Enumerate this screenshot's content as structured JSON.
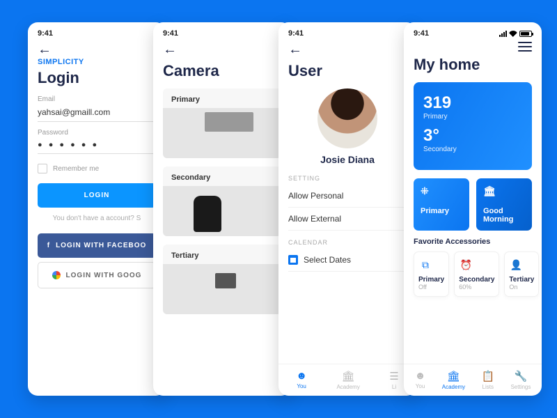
{
  "time": "9:41",
  "login": {
    "brand": "SIMPLICITY",
    "title": "Login",
    "email_label": "Email",
    "email_value": "yahsai@gmaill.com",
    "password_label": "Password",
    "password_value": "● ● ● ● ● ●",
    "remember": "Remember me",
    "login_btn": "LOGIN",
    "hint": "You don't have a account? S",
    "fb_btn": "LOGIN WITH FACEBOO",
    "gg_btn": "LOGIN WITH GOOG"
  },
  "camera": {
    "title": "Camera",
    "cards": [
      "Primary",
      "Secondary",
      "Tertiary"
    ]
  },
  "user": {
    "title": "User",
    "name": "Josie Diana",
    "setting_header": "SETTING",
    "settings": [
      "Allow Personal",
      "Allow External"
    ],
    "calendar_header": "CALENDAR",
    "calendar_item": "Select Dates"
  },
  "home": {
    "title": "My home",
    "hero": {
      "v1": "319",
      "l1": "Primary",
      "v2": "3°",
      "l2": "Secondary"
    },
    "tiles": [
      {
        "icon": "⁜",
        "label": "Primary"
      },
      {
        "icon": "🏛",
        "label": "Good Morning"
      }
    ],
    "fav_header": "Favorite Accessories",
    "favs": [
      {
        "icon": "⧉",
        "title": "Primary",
        "sub": "Off"
      },
      {
        "icon": "⏰",
        "title": "Secondary",
        "sub": "60%"
      },
      {
        "icon": "👤",
        "title": "Tertiary",
        "sub": "On"
      }
    ]
  },
  "tabs": {
    "you": "You",
    "academy": "Academy",
    "lists": "Lists",
    "settings": "Settings",
    "li": "Li"
  }
}
